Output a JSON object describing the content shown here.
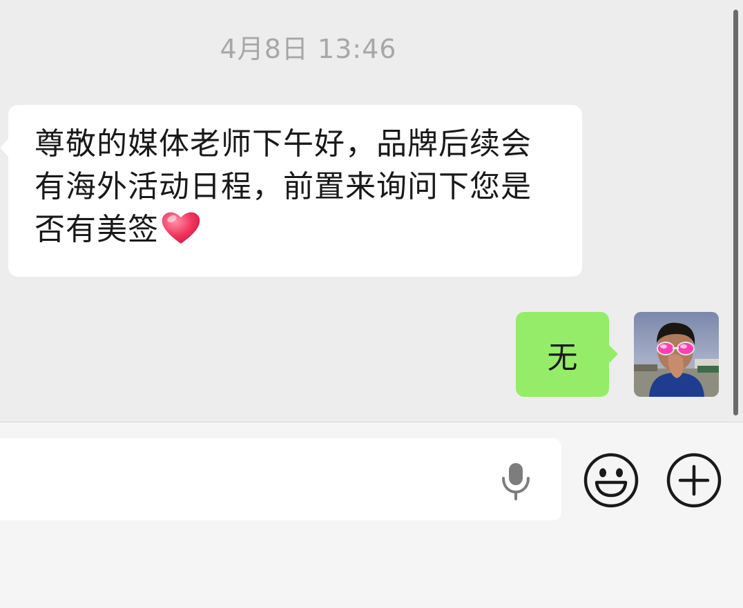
{
  "chat": {
    "timestamp": "4月8日 13:46",
    "messages": [
      {
        "direction": "incoming",
        "text": "尊敬的媒体老师下午好，品牌后续会有海外活动日程，前置来询问下您是否有美签",
        "emoji": "heart-emoji"
      },
      {
        "direction": "outgoing",
        "text": "无"
      }
    ]
  },
  "input_bar": {
    "voice_icon": "microphone-icon",
    "emoji_icon": "smiley-icon",
    "more_icon": "plus-icon"
  },
  "colors": {
    "chat_background": "#ededed",
    "incoming_bubble": "#ffffff",
    "outgoing_bubble": "#95ec69",
    "timestamp_text": "#a7a7a7",
    "input_bar_background": "#f5f5f5",
    "icon_stroke": "#1a1a1a"
  }
}
